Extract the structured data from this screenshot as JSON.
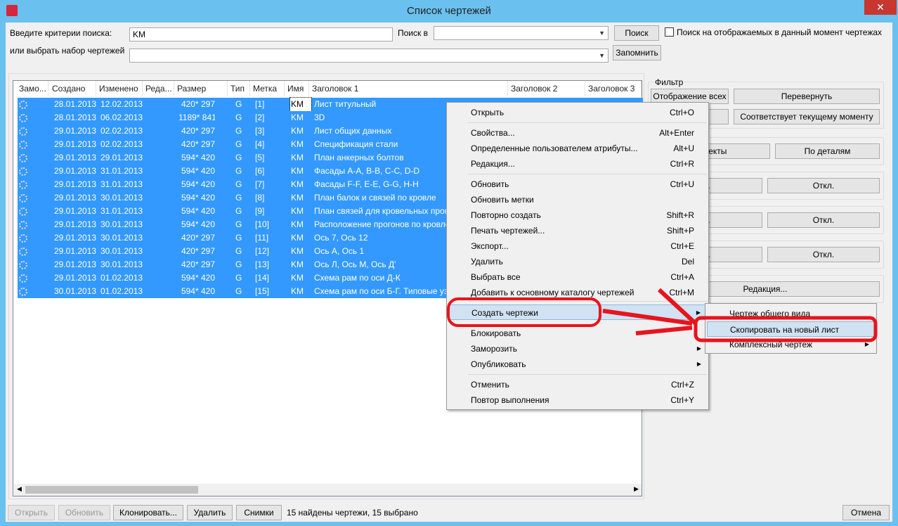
{
  "window": {
    "title": "Список чертежей",
    "close": "✕"
  },
  "search": {
    "criteria_label": "Введите критерии поиска:",
    "criteria_value": "KM",
    "search_in_label": "Поиск в",
    "search_in_value": "",
    "search_button": "Поиск",
    "only_shown_label": "Поиск на отображаемых в данный момент чертежах",
    "set_label": "или выбрать набор чертежей",
    "set_value": "",
    "remember_button": "Запомнить"
  },
  "table": {
    "columns": [
      "Замо...",
      "Создано",
      "Изменено",
      "Реда...",
      "Размер",
      "Тип",
      "Метка",
      "Имя",
      "Заголовок 1",
      "Заголовок 2",
      "Заголовок 3"
    ],
    "rows": [
      [
        "28.01.2013",
        "12.02.2013",
        "420* 297",
        "G",
        "[1]",
        "KM",
        "Лист титульный"
      ],
      [
        "28.01.2013",
        "06.02.2013",
        "1189* 841",
        "G",
        "[2]",
        "KM",
        "3D"
      ],
      [
        "29.01.2013",
        "02.02.2013",
        "420* 297",
        "G",
        "[3]",
        "KM",
        "Лист общих данных"
      ],
      [
        "29.01.2013",
        "02.02.2013",
        "420* 297",
        "G",
        "[4]",
        "KM",
        "Спецификация стали"
      ],
      [
        "29.01.2013",
        "29.01.2013",
        "594* 420",
        "G",
        "[5]",
        "KM",
        "План анкерных болтов"
      ],
      [
        "29.01.2013",
        "31.01.2013",
        "594* 420",
        "G",
        "[6]",
        "KM",
        "Фасады А-А, В-В, С-С, D-D"
      ],
      [
        "29.01.2013",
        "31.01.2013",
        "594* 420",
        "G",
        "[7]",
        "KM",
        "Фасады F-F, E-E, G-G, H-H"
      ],
      [
        "29.01.2013",
        "30.01.2013",
        "594* 420",
        "G",
        "[8]",
        "KM",
        "План балок и связей по кровле"
      ],
      [
        "29.01.2013",
        "31.01.2013",
        "594* 420",
        "G",
        "[9]",
        "KM",
        "План связей для кровельных прогонов"
      ],
      [
        "29.01.2013",
        "30.01.2013",
        "594* 420",
        "G",
        "[10]",
        "KM",
        "Расположение прогонов по кровле"
      ],
      [
        "29.01.2013",
        "30.01.2013",
        "420* 297",
        "G",
        "[11]",
        "KM",
        "Ось 7, Ось 12"
      ],
      [
        "29.01.2013",
        "30.01.2013",
        "420* 297",
        "G",
        "[12]",
        "KM",
        "Ось А, Ось 1"
      ],
      [
        "29.01.2013",
        "30.01.2013",
        "420* 297",
        "G",
        "[13]",
        "KM",
        "Ось Л, Ось М, Ось Д'"
      ],
      [
        "29.01.2013",
        "01.02.2013",
        "594* 420",
        "G",
        "[14]",
        "KM",
        "Схема рам по оси Д-К"
      ],
      [
        "30.01.2013",
        "01.02.2013",
        "594* 420",
        "G",
        "[15]",
        "KM",
        "Схема рам по оси Б-Г. Типовые узлы"
      ]
    ]
  },
  "filter": {
    "title": "Фильтр",
    "show_all": "Отображение всех",
    "invert": "Перевернуть",
    "current": "Соответствует текущему моменту",
    "objects": "объекты",
    "by_parts": "По деталям",
    "off1a": "л.",
    "off1": "Откл.",
    "off2a": "л.",
    "off2": "Откл.",
    "off3a": "л.",
    "off3": "Откл.",
    "edit": "Редакция..."
  },
  "context_menu": {
    "items": [
      {
        "label": "Открыть",
        "shortcut": "Ctrl+O"
      },
      {
        "label": "Свойства...",
        "shortcut": "Alt+Enter"
      },
      {
        "label": "Определенные пользователем атрибуты...",
        "shortcut": "Alt+U"
      },
      {
        "label": "Редакция...",
        "shortcut": "Ctrl+R"
      },
      {
        "label": "Обновить",
        "shortcut": "Ctrl+U"
      },
      {
        "label": "Обновить метки",
        "shortcut": ""
      },
      {
        "label": "Повторно создать",
        "shortcut": "Shift+R"
      },
      {
        "label": "Печать чертежей...",
        "shortcut": "Shift+P"
      },
      {
        "label": "Экспорт...",
        "shortcut": "Ctrl+E"
      },
      {
        "label": "Удалить",
        "shortcut": "Del"
      },
      {
        "label": "Выбрать все",
        "shortcut": "Ctrl+A"
      },
      {
        "label": "Добавить к основному каталогу чертежей",
        "shortcut": "Ctrl+M"
      },
      {
        "label": "Создать чертежи",
        "shortcut": ""
      },
      {
        "label": "Блокировать",
        "shortcut": ""
      },
      {
        "label": "Заморозить",
        "shortcut": ""
      },
      {
        "label": "Опубликовать",
        "shortcut": ""
      },
      {
        "label": "Отменить",
        "shortcut": "Ctrl+Z"
      },
      {
        "label": "Повтор выполнения",
        "shortcut": "Ctrl+Y"
      }
    ]
  },
  "submenu": {
    "items": [
      "Чертеж общего вида",
      "Скопировать на новый лист",
      "Комплексный чертеж"
    ]
  },
  "bottom": {
    "open": "Открыть",
    "refresh": "Обновить",
    "clone": "Клонировать...",
    "delete": "Удалить",
    "snapshots": "Снимки",
    "status": "15 найдены чертежи, 15 выбрано",
    "cancel": "Отмена"
  },
  "colors": {
    "selection": "#3399ff",
    "annotation": "#e8141c"
  }
}
